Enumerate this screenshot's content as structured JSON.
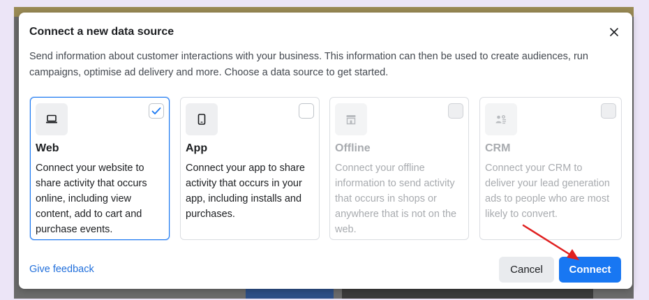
{
  "modal": {
    "title": "Connect a new data source",
    "description": "Send information about customer interactions with your business. This information can then be used to create audiences, run campaigns, optimise ad delivery and more. Choose a data source to get started."
  },
  "cards": [
    {
      "title": "Web",
      "description": "Connect your website to share activity that occurs online, including view content, add to cart and purchase events.",
      "icon": "laptop-icon",
      "selected": true,
      "disabled": false
    },
    {
      "title": "App",
      "description": "Connect your app to share activity that occurs in your app, including installs and purchases.",
      "icon": "mobile-icon",
      "selected": false,
      "disabled": false
    },
    {
      "title": "Offline",
      "description": "Connect your offline information to send activity that occurs in shops or anywhere that is not on the web.",
      "icon": "store-icon",
      "selected": false,
      "disabled": true
    },
    {
      "title": "CRM",
      "description": "Connect your CRM to deliver your lead generation ads to people who are most likely to convert.",
      "icon": "people-icon",
      "selected": false,
      "disabled": true
    }
  ],
  "footer": {
    "feedback_label": "Give feedback",
    "cancel_label": "Cancel",
    "connect_label": "Connect"
  },
  "colors": {
    "primary": "#1877f2",
    "link": "#216fdb",
    "annotation_arrow": "#e02020"
  }
}
